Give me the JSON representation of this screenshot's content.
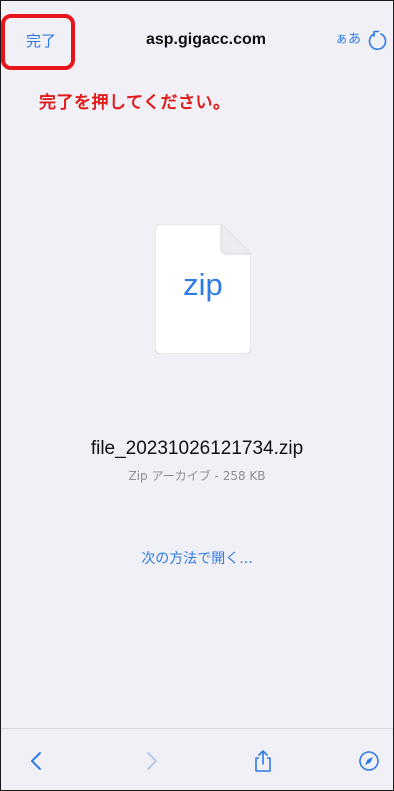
{
  "header": {
    "done_label": "完了",
    "url": "asp.gigacc.com",
    "aa_label": "ぁあ",
    "reload_icon": "reload-icon"
  },
  "instruction": "完了を押してください。",
  "file": {
    "ext_label": "zip",
    "name": "file_20231026121734.zip",
    "meta": "Zip アーカイブ - 258 KB"
  },
  "open_with_label": "次の方法で開く...",
  "toolbar": {
    "icons": [
      "back-icon",
      "forward-icon",
      "share-icon",
      "compass-icon"
    ]
  },
  "colors": {
    "accent": "#2f7be5",
    "highlight": "#e8141b",
    "background": "#f1f0f6"
  }
}
